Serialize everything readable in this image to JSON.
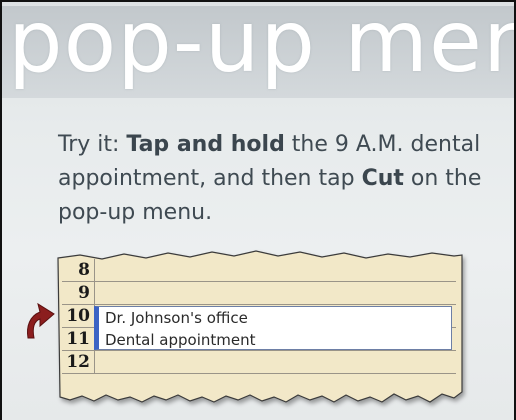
{
  "banner": {
    "title": "pop-up menus"
  },
  "instructions": {
    "lead": "Try it: ",
    "bold1": "Tap and hold",
    "mid": " the 9 A.M. dental appointment, and then tap ",
    "bold2": "Cut",
    "tail": " on the pop-up menu."
  },
  "calendar": {
    "hours": [
      "8",
      "9",
      "10",
      "11",
      "12"
    ],
    "appointment": {
      "line1": "Dr. Johnson's office",
      "line2": "Dental appointment"
    }
  },
  "colors": {
    "banner_text": "#ffffff",
    "card_bg": "#f2e8c8",
    "appointment_accent": "#3b63c4",
    "arrow": "#8b1e1e"
  },
  "icons": {
    "pointer": "curved-arrow-icon"
  }
}
